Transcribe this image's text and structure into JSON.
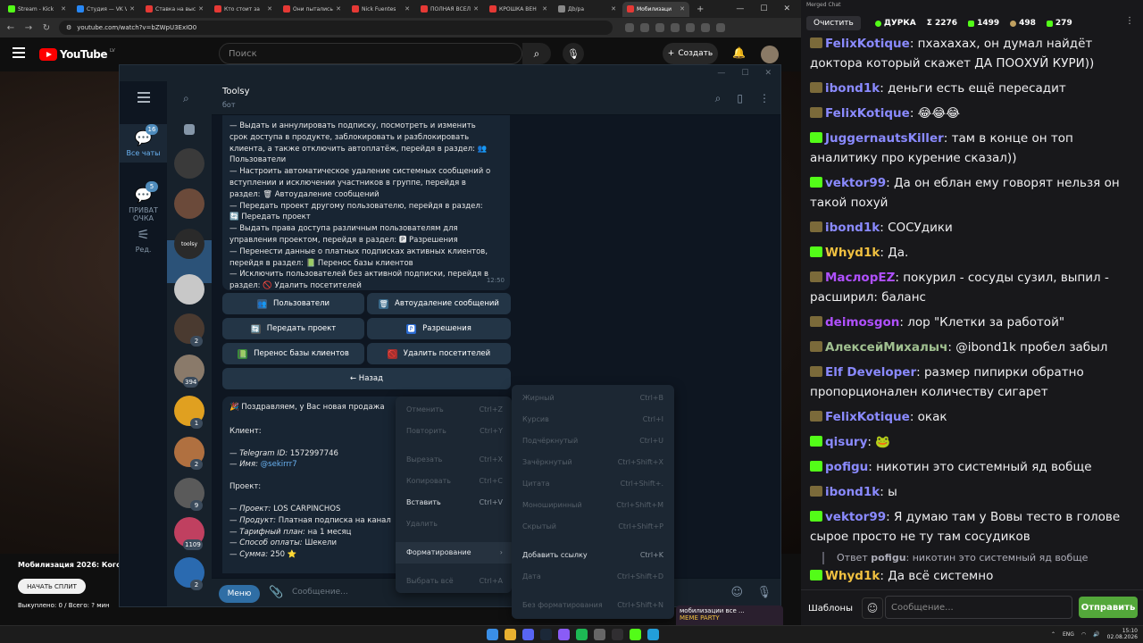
{
  "browser": {
    "tabs": [
      {
        "label": "Stream - Kick",
        "color": "#53fc18",
        "active": false
      },
      {
        "label": "Студия — VK Video",
        "color": "#2787f5",
        "active": false
      },
      {
        "label": "Ставка на выс",
        "color": "#e53935",
        "active": false
      },
      {
        "label": "Кто стоит за",
        "color": "#e53935",
        "active": false
      },
      {
        "label": "Они пытались",
        "color": "#e53935",
        "active": false
      },
      {
        "label": "Nick Fuentes",
        "color": "#e53935",
        "active": false
      },
      {
        "label": "ПОЛНАЯ ВСЕЛ",
        "color": "#e53935",
        "active": false
      },
      {
        "label": "КРОШКА ВЕН",
        "color": "#e53935",
        "active": false
      },
      {
        "label": "Дb/pa",
        "color": "#888888",
        "active": false
      },
      {
        "label": "Мобилизаци",
        "color": "#e53935",
        "active": true
      }
    ],
    "new_tab": "+",
    "url": "youtube.com/watch?v=bZWpU3ExIO0"
  },
  "youtube": {
    "logo": "YouTube",
    "region": "LV",
    "search_placeholder": "Поиск",
    "create_label": "Создать",
    "video_title": "Мобилизация 2026: Кого не",
    "split_button": "НАЧАТЬ СПЛИТ",
    "bought_text": "Выкуплено: 0 / Всего: ? мин"
  },
  "telegram": {
    "folders": [
      {
        "label": "Все чаты",
        "badge": "16",
        "icon": "chat-bubble-icon"
      },
      {
        "label": "ПРИВАТ ОЧКА",
        "badge": "5",
        "icon": "chat-bubble-icon"
      },
      {
        "label": "Ред.",
        "badge": "",
        "icon": "sliders-icon"
      }
    ],
    "chats": [
      {
        "badge": "",
        "color": "#3a3a3a"
      },
      {
        "badge": "",
        "color": "#6b4a3a"
      },
      {
        "badge": "",
        "color": "#2a2a2a",
        "label": "toolsy",
        "selected": true
      },
      {
        "badge": "",
        "color": "#c8c8c8"
      },
      {
        "badge": "2",
        "color": "#4a3a30"
      },
      {
        "badge": "394",
        "color": "#8a7a6a"
      },
      {
        "badge": "1",
        "color": "#e0a020"
      },
      {
        "badge": "2",
        "color": "#b07040"
      },
      {
        "badge": "9",
        "color": "#5a5a5a"
      },
      {
        "badge": "1109",
        "color": "#c04060"
      },
      {
        "badge": "2",
        "color": "#2a6ab0"
      }
    ],
    "chat_name": "Toolsy",
    "chat_status": "бот",
    "message1": {
      "lines": [
        "— Выдать и аннулировать подписку, посмотреть и изменить",
        "срок доступа в продукте, заблокировать и разблокировать",
        "клиента, а также отключить автоплатёж, перейдя в раздел: 👥",
        "Пользователи",
        "— Настроить автоматическое удаление системных сообщений о",
        "вступлении и исключении участников в группе, перейдя в",
        "раздел: 🗑 Автоудаление сообщений",
        "— Передать проект другому пользователю, перейдя в раздел:",
        "🔄 Передать проект",
        "— Выдать права доступа различным пользователям для",
        "управления проектом, перейдя в раздел: 🅿 Разрешения",
        "— Перенести данные о платных подписках активных клиентов,",
        "перейдя в раздел: 📗 Перенос базы клиентов",
        "— Исключить пользователей без активной подписки, перейдя в",
        "раздел: 🚫 Удалить посетителей"
      ],
      "time": "12:50"
    },
    "keyboard": [
      {
        "label": "Пользователи",
        "emoji": "👥"
      },
      {
        "label": "Автоудаление сообщений",
        "emoji": "🗑"
      },
      {
        "label": "Передать проект",
        "emoji": "🔄"
      },
      {
        "label": "Разрешения",
        "emoji": "🅿"
      },
      {
        "label": "Перенос базы клиентов",
        "emoji": "📗"
      },
      {
        "label": "Удалить посетителей",
        "emoji": "🚫"
      },
      {
        "label": "← Назад",
        "emoji": ""
      }
    ],
    "message2": {
      "header": "Поздравляем, у Вас новая продажа",
      "client_label": "Клиент:",
      "telegram_id_key": "Telegram ID:",
      "telegram_id": "1572997746",
      "name_key": "Имя:",
      "name": "@sekirrr7",
      "project_label": "Проект:",
      "project_key": "Проект:",
      "project": "LOS CARPINCHOS",
      "product_key": "Продукт:",
      "product": "Платная подписка на канал",
      "plan_key": "Тарифный план:",
      "plan": "на 1 месяц",
      "pay_key": "Способ оплаты:",
      "pay": "Шекели",
      "sum_key": "Сумма:",
      "sum": "250 ⭐"
    },
    "input": {
      "menu_button": "Меню",
      "placeholder": "Сообщение..."
    },
    "context_menu": [
      {
        "label": "Отменить",
        "shortcut": "Ctrl+Z",
        "enabled": false
      },
      {
        "label": "Повторить",
        "shortcut": "Ctrl+Y",
        "enabled": false
      },
      {
        "label": "Вырезать",
        "shortcut": "Ctrl+X",
        "enabled": false
      },
      {
        "label": "Копировать",
        "shortcut": "Ctrl+C",
        "enabled": false
      },
      {
        "label": "Вставить",
        "shortcut": "Ctrl+V",
        "enabled": true
      },
      {
        "label": "Удалить",
        "shortcut": "",
        "enabled": false
      },
      {
        "label": "Форматирование",
        "shortcut": "›",
        "enabled": true
      },
      {
        "label": "Выбрать всё",
        "shortcut": "Ctrl+A",
        "enabled": false
      }
    ],
    "format_menu": [
      {
        "label": "Жирный",
        "shortcut": "Ctrl+B",
        "enabled": false
      },
      {
        "label": "Курсив",
        "shortcut": "Ctrl+I",
        "enabled": false
      },
      {
        "label": "Подчёркнутый",
        "shortcut": "Ctrl+U",
        "enabled": false
      },
      {
        "label": "Зачёркнутый",
        "shortcut": "Ctrl+Shift+X",
        "enabled": false
      },
      {
        "label": "Цитата",
        "shortcut": "Ctrl+Shift+.",
        "enabled": false
      },
      {
        "label": "Моноширинный",
        "shortcut": "Ctrl+Shift+M",
        "enabled": false
      },
      {
        "label": "Скрытый",
        "shortcut": "Ctrl+Shift+P",
        "enabled": false
      },
      {
        "label": "Добавить ссылку",
        "shortcut": "Ctrl+K",
        "enabled": true
      },
      {
        "label": "Дата",
        "shortcut": "Ctrl+Shift+D",
        "enabled": false
      },
      {
        "label": "Без форматирования",
        "shortcut": "Ctrl+Shift+N",
        "enabled": false
      }
    ]
  },
  "chat_panel": {
    "title": "Merged Chat",
    "clear_button": "Очистить",
    "stats": [
      {
        "label": "ДУРКА",
        "icon": "dot-icon"
      },
      {
        "label": "Σ 2276",
        "icon": ""
      },
      {
        "label": "1499",
        "icon": "kick-icon"
      },
      {
        "label": "498",
        "icon": "user-icon"
      },
      {
        "label": "279",
        "icon": "kick-icon"
      }
    ],
    "messages": [
      {
        "badge": "s",
        "nick": "FelixKotique",
        "color": "#8a8aff",
        "text": "пхахахах, он думал найдёт доктора который скажет ДА ПООХУЙ КУРИ))"
      },
      {
        "badge": "s",
        "nick": "ibond1k",
        "color": "#8a8aff",
        "text": "деньги есть ещё пересадит"
      },
      {
        "badge": "s",
        "nick": "FelixKotique",
        "color": "#8a8aff",
        "text": "😂😂😂"
      },
      {
        "badge": "k",
        "nick": "JuggernautsKiller",
        "color": "#8a8aff",
        "text": "там в конце  он топ аналитику про курение сказал))"
      },
      {
        "badge": "k",
        "nick": "vektor99",
        "color": "#8a8aff",
        "text": "Да он еблан ему говорят нельзя он такой похуй"
      },
      {
        "badge": "s",
        "nick": "ibond1k",
        "color": "#8a8aff",
        "text": "СОСУдики"
      },
      {
        "badge": "k",
        "nick": "Whyd1k",
        "color": "#f0c040",
        "text": "Да."
      },
      {
        "badge": "s",
        "nick": "МаслорEZ",
        "color": "#b050ff",
        "text": "покурил - сосуды сузил, выпил - расширил: баланс"
      },
      {
        "badge": "s",
        "nick": "deimosgon",
        "color": "#b050ff",
        "text": "лор \"Клетки за работой\""
      },
      {
        "badge": "s",
        "nick": "АлексейМихалыч",
        "color": "#a0c090",
        "text": "@ibond1k пробел забыл"
      },
      {
        "badge": "s",
        "nick": "Elf Developer",
        "color": "#8a8aff",
        "text": "размер пипирки обратно пропорционален количеству сигарет"
      },
      {
        "badge": "s",
        "nick": "FelixKotique",
        "color": "#8a8aff",
        "text": "окак"
      },
      {
        "badge": "k",
        "nick": "qisury",
        "color": "#8a8aff",
        "text": "🐸"
      },
      {
        "badge": "k",
        "nick": "pofigu",
        "color": "#8a8aff",
        "text": "никотин это системный яд вобще"
      },
      {
        "badge": "s",
        "nick": "ibond1k",
        "color": "#8a8aff",
        "text": "ы"
      },
      {
        "badge": "k",
        "nick": "vektor99",
        "color": "#8a8aff",
        "text": "Я думаю там у Вовы тесто в голове сырое просто не ту там сосудиков"
      }
    ],
    "reply": {
      "prefix": "Ответ",
      "nick": "pofigu",
      "text": "никотин это системный яд вобще"
    },
    "last_message": {
      "badge": "k",
      "nick": "Whyd1k",
      "color": "#f0c040",
      "text": "Да всё системно"
    },
    "templates_button": "Шаблоны",
    "input_placeholder": "Сообщение...",
    "send_button": "Отправить"
  },
  "taskbar": {
    "lang": "ENG",
    "time": "15:10",
    "date": "02.08.2026",
    "promo_title": "мобилизации все ...",
    "promo_sub": "MEME PARTY"
  }
}
